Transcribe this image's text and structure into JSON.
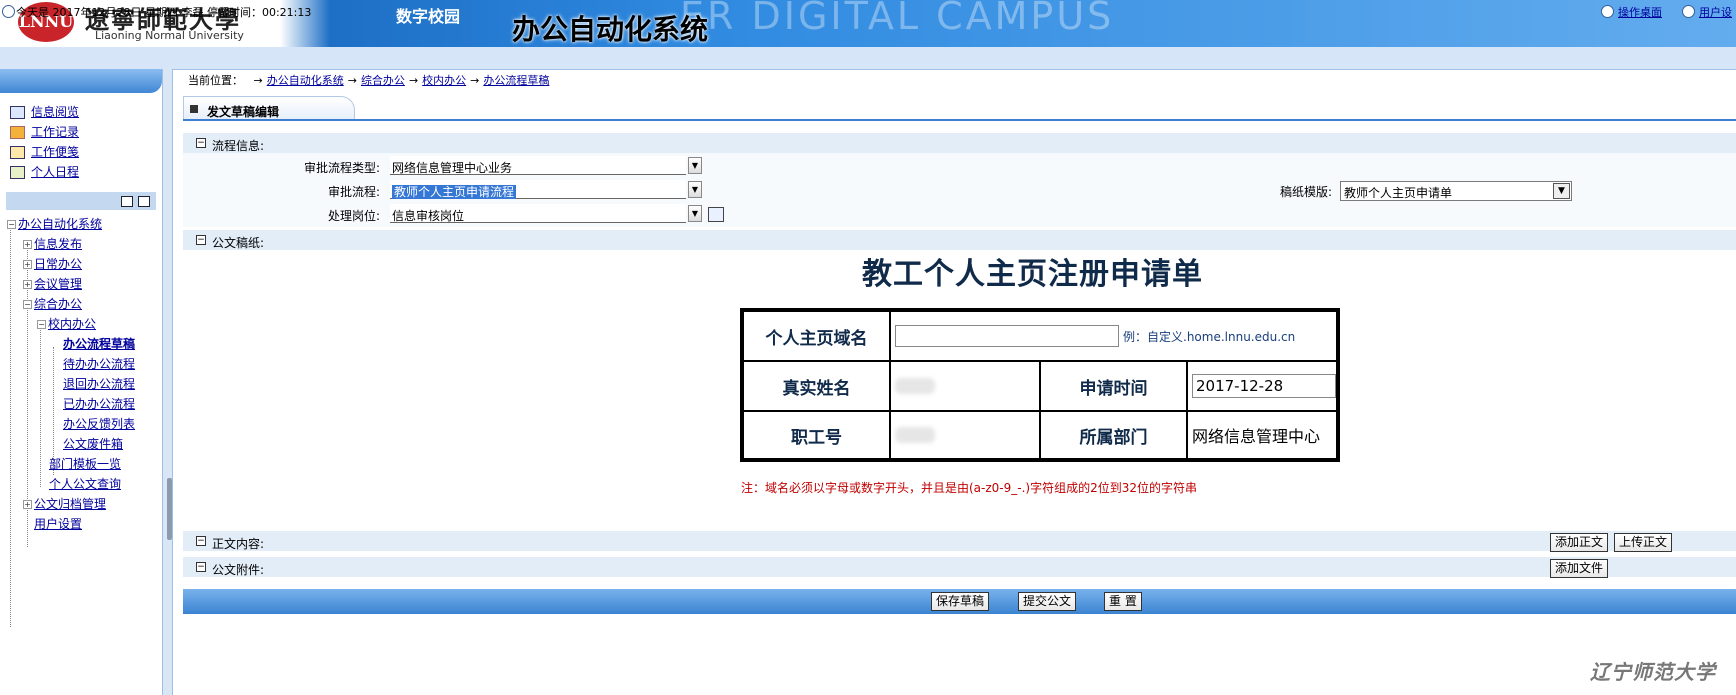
{
  "header": {
    "logo_text": "LNNU",
    "univ_cn": "遼寧師範大學",
    "univ_en": "Liaoning Normal University",
    "campus": "数字校园",
    "system_title": "办公自动化系统",
    "watermark": "ER DIGITAL CAMPUS"
  },
  "status": {
    "text": "今天是 2017年12月28日 星期四   李磊   停留时间：00:21:13",
    "desktop_link": "操作桌面",
    "user_link": "用户设"
  },
  "sidebar": {
    "quick": [
      {
        "label": "信息阅览",
        "icon": "news-icon"
      },
      {
        "label": "工作记录",
        "icon": "pencil-icon"
      },
      {
        "label": "工作便笺",
        "icon": "notepad-icon"
      },
      {
        "label": "个人日程",
        "icon": "calendar-icon"
      }
    ],
    "tree": {
      "root": "办公自动化系统",
      "items": [
        "信息发布",
        "日常办公",
        "会议管理",
        "综合办公",
        "校内办公",
        "办公流程草稿",
        "待办办公流程",
        "退回办公流程",
        "已办办公流程",
        "办公反馈列表",
        "公文废件箱",
        "部门模板一览",
        "个人公文查询",
        "公文归档管理",
        "用户设置"
      ]
    }
  },
  "breadcrumb": {
    "label": "当前位置：",
    "items": [
      "办公自动化系统",
      "综合办公",
      "校内办公",
      "办公流程草稿"
    ]
  },
  "tab": {
    "label": "发文草稿编辑"
  },
  "sections": {
    "flow": "流程信息:",
    "draft": "公文稿纸:",
    "body": "正文内容:",
    "attach": "公文附件:"
  },
  "flow_form": {
    "type_label": "审批流程类型:",
    "type_value": "网络信息管理中心业务",
    "flow_label": "审批流程:",
    "flow_value": "教师个人主页申请流程",
    "post_label": "处理岗位:",
    "post_value": "信息审核岗位",
    "template_label": "稿纸模版:",
    "template_value": "教师个人主页申请单"
  },
  "doc": {
    "title": "教工个人主页注册申请单",
    "domain_label": "个人主页域名",
    "domain_value": "",
    "domain_hint": "例：自定义.home.lnnu.edu.cn",
    "name_label": "真实姓名",
    "date_label": "申请时间",
    "date_value": "2017-12-28",
    "staff_label": "职工号",
    "dept_label": "所属部门",
    "dept_value": "网络信息管理中心",
    "note": "注：域名必须以字母或数字开头，并且是由(a-z0-9_-.)字符组成的2位到32位的字符串"
  },
  "buttons": {
    "add_body": "添加正文",
    "upload_body": "上传正文",
    "add_file": "添加文件",
    "save": "保存草稿",
    "submit": "提交公文",
    "reset": "重 置"
  },
  "footer_mark": "辽宁师范大学"
}
